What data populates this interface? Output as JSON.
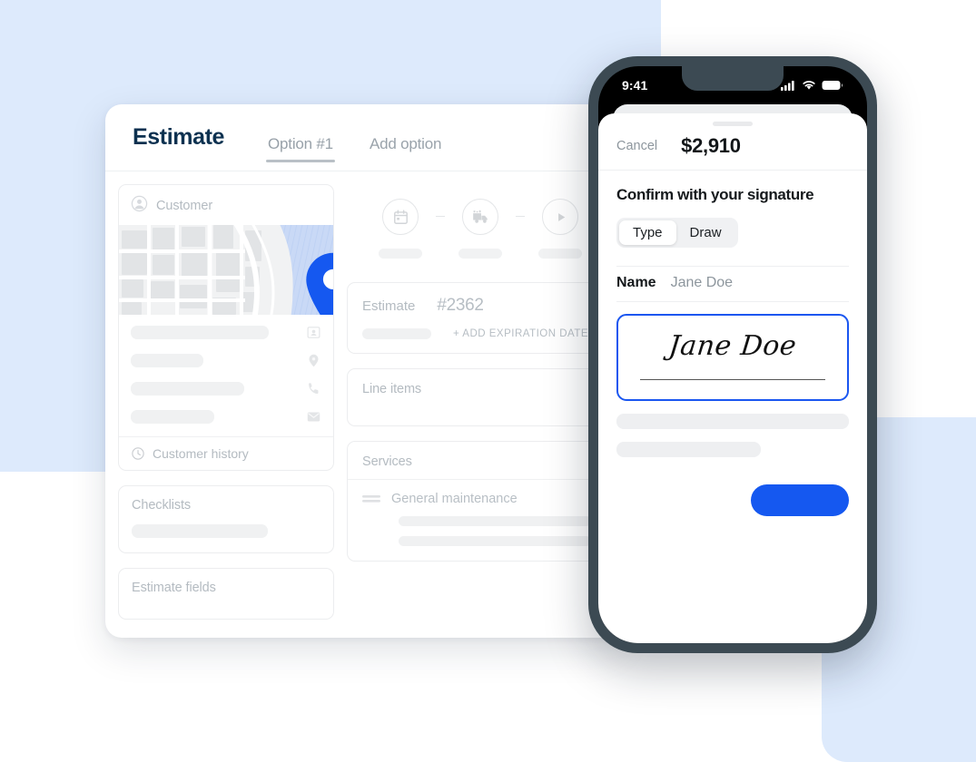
{
  "desktop": {
    "title": "Estimate",
    "tabs": [
      {
        "label": "Option #1",
        "active": true
      },
      {
        "label": "Add option",
        "active": false
      }
    ],
    "customer_card": {
      "label": "Customer",
      "icon": "customer-avatar-icon",
      "map": {
        "pin_icon": "map-pin-icon",
        "pin_color": "#1558f0",
        "land_color": "#e3e5e6",
        "water_color": "#c7d8f5"
      },
      "detail_rows": [
        {
          "icon": "contact-card-icon",
          "value": ""
        },
        {
          "icon": "location-pin-icon",
          "value": ""
        },
        {
          "icon": "phone-icon",
          "value": ""
        },
        {
          "icon": "email-icon",
          "value": ""
        }
      ],
      "history_label": "Customer history",
      "history_icon": "clock-history-icon"
    },
    "checklists_card": {
      "label": "Checklists"
    },
    "estimate_fields_card": {
      "label": "Estimate fields"
    },
    "steps": [
      {
        "icon": "calendar-icon",
        "label": ""
      },
      {
        "icon": "truck-icon",
        "label": ""
      },
      {
        "icon": "play-icon",
        "label": ""
      }
    ],
    "estimate_card": {
      "label": "Estimate",
      "number": "#2362",
      "add_expiration_label": "+ ADD EXPIRATION DATE"
    },
    "line_items_card": {
      "label": "Line items"
    },
    "services_card": {
      "label": "Services",
      "items": [
        {
          "name": "General maintenance",
          "icon": "drag-handle-icon"
        }
      ]
    }
  },
  "phone": {
    "status_bar": {
      "time": "9:41",
      "icons": [
        "signal-icon",
        "wifi-icon",
        "battery-icon"
      ]
    },
    "sheet": {
      "cancel_label": "Cancel",
      "amount": "$2,910",
      "heading": "Confirm with your signature",
      "segmented": {
        "options": [
          {
            "label": "Type",
            "selected": true
          },
          {
            "label": "Draw",
            "selected": false
          }
        ]
      },
      "name_label": "Name",
      "name_value": "Jane Doe",
      "signature_value": "Jane Doe",
      "signature_border_color": "#1a56f0",
      "submit_button_label": "",
      "submit_button_color": "#1558f0"
    }
  },
  "background": {
    "accent_panel_color": "#ddeafc",
    "brand_blue": "#1558f0",
    "title_navy": "#0d3150"
  }
}
